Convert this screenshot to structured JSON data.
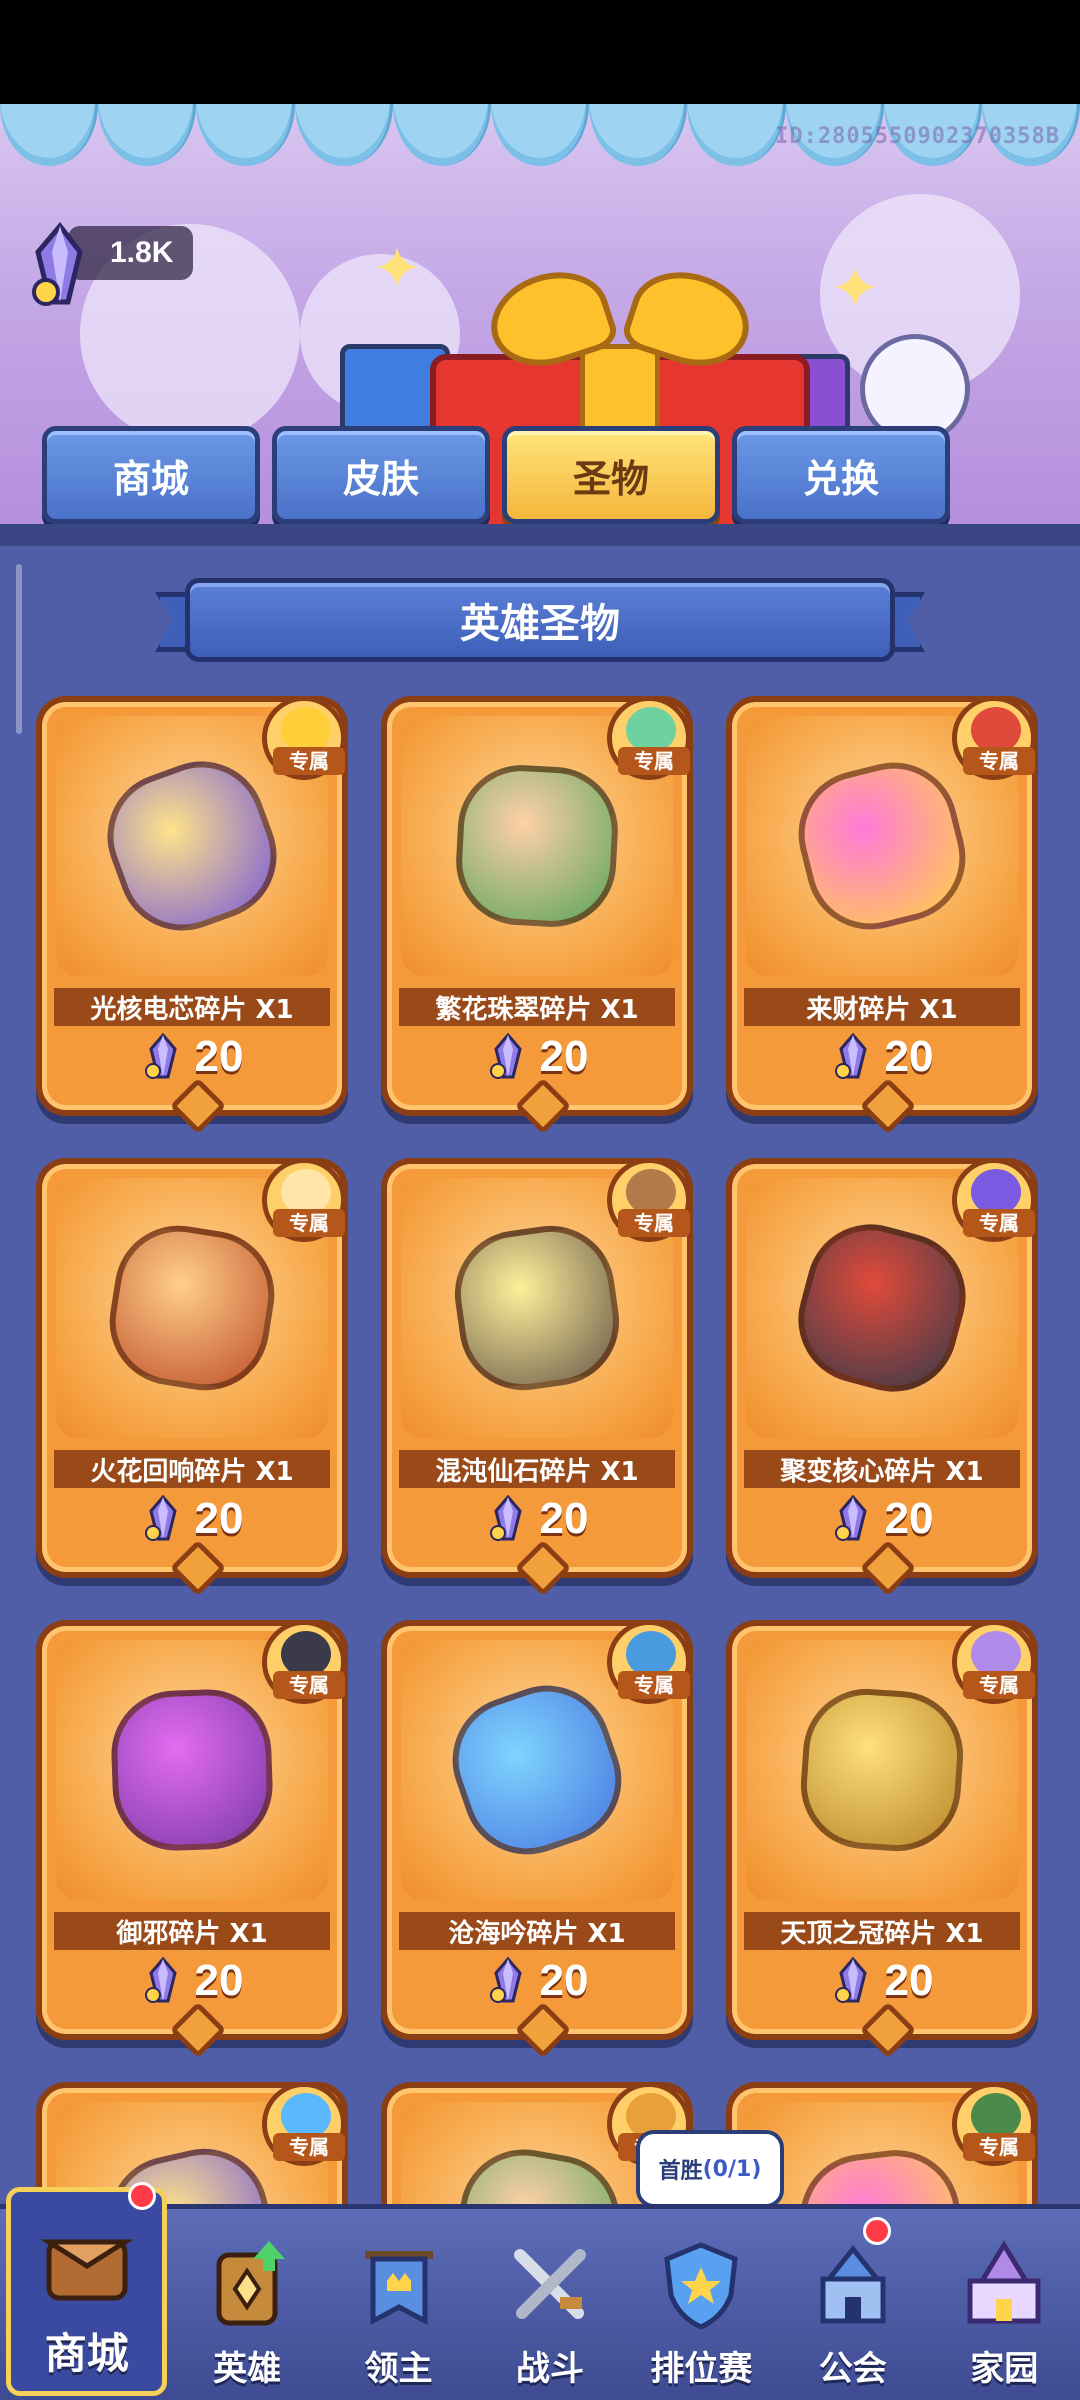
{
  "banner": {
    "id_text": "ID:2805550902370358B",
    "currency_amount": "1.8K"
  },
  "tabs": [
    {
      "label": "商城",
      "active": false
    },
    {
      "label": "皮肤",
      "active": false
    },
    {
      "label": "圣物",
      "active": true
    },
    {
      "label": "兑换",
      "active": false
    }
  ],
  "section": {
    "title": "英雄圣物"
  },
  "exclusive_tag": "专属",
  "items": [
    {
      "name": "光核电芯碎片 X1",
      "price": "20"
    },
    {
      "name": "繁花珠翠碎片 X1",
      "price": "20"
    },
    {
      "name": "来财碎片 X1",
      "price": "20"
    },
    {
      "name": "火花回响碎片 X1",
      "price": "20"
    },
    {
      "name": "混沌仙石碎片 X1",
      "price": "20"
    },
    {
      "name": "聚变核心碎片 X1",
      "price": "20"
    },
    {
      "name": "御邪碎片 X1",
      "price": "20"
    },
    {
      "name": "沧海吟碎片 X1",
      "price": "20"
    },
    {
      "name": "天顶之冠碎片 X1",
      "price": "20"
    }
  ],
  "first_win": {
    "label": "首胜",
    "progress": "(0/1)"
  },
  "nav": [
    {
      "label": "商城",
      "icon": "shop-icon",
      "active": true
    },
    {
      "label": "英雄",
      "icon": "hero-card-icon",
      "active": false
    },
    {
      "label": "领主",
      "icon": "lord-banner-icon",
      "active": false
    },
    {
      "label": "战斗",
      "icon": "crossed-swords-icon",
      "active": false
    },
    {
      "label": "排位赛",
      "icon": "rank-shield-icon",
      "active": false
    },
    {
      "label": "公会",
      "icon": "guild-castle-icon",
      "active": false
    },
    {
      "label": "家园",
      "icon": "home-castle-icon",
      "active": false
    }
  ],
  "colors": {
    "content_bg": "#4f5ea6",
    "card_orange": "#f49a3a",
    "tab_active": "#f4b63c",
    "tab_inactive": "#4a72c9"
  }
}
